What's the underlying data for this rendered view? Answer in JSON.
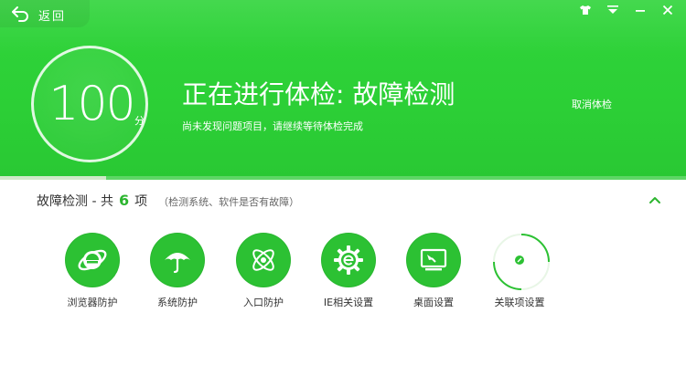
{
  "header": {
    "back_label": "返回",
    "score": "100",
    "score_unit": "分",
    "title": "正在进行体检: 故障检测",
    "subtitle": "尚未发现问题项目，请继续等待体检完成",
    "cancel_label": "取消体检",
    "progress_fraction": 0.155,
    "window_controls": [
      "skin-icon",
      "menu-icon",
      "minimize-icon",
      "close-icon"
    ]
  },
  "section": {
    "title": "故障检测 - 共",
    "count": "6",
    "unit": "项",
    "description": "（检测系统、软件是否有故障）"
  },
  "items": [
    {
      "label": "浏览器防护",
      "icon": "ie-icon",
      "state": "done"
    },
    {
      "label": "系统防护",
      "icon": "umbrella-icon",
      "state": "done"
    },
    {
      "label": "入口防护",
      "icon": "atom-icon",
      "state": "done"
    },
    {
      "label": "IE相关设置",
      "icon": "gear-e-icon",
      "state": "done"
    },
    {
      "label": "桌面设置",
      "icon": "desktop-icon",
      "state": "done"
    },
    {
      "label": "关联项设置",
      "icon": "link-icon",
      "state": "scanning"
    }
  ],
  "colors": {
    "brand_green": "#2ccf36",
    "icon_green": "#2cc133",
    "count_green": "#2cb52f"
  }
}
